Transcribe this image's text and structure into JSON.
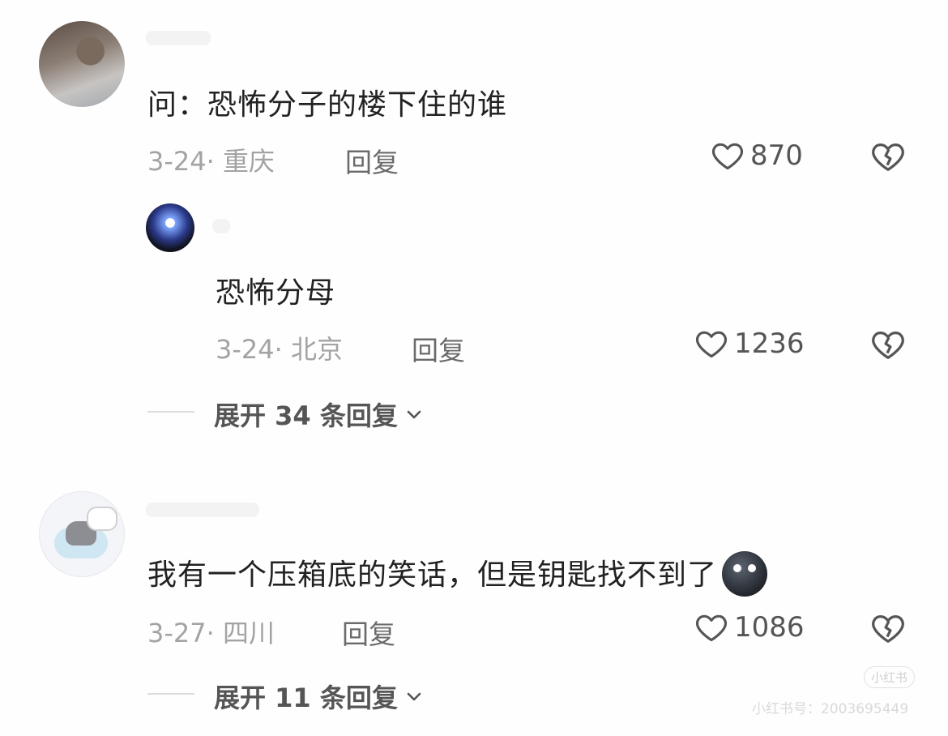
{
  "comments": [
    {
      "text": "问：恐怖分子的楼下住的谁",
      "date": "3-24",
      "location": "重庆",
      "reply_label": "回复",
      "likes": "870",
      "sub_reply": {
        "text": "恐怖分母",
        "date": "3-24",
        "location": "北京",
        "reply_label": "回复",
        "likes": "1236"
      },
      "expand_label": "展开 34 条回复"
    },
    {
      "text": "我有一个压箱底的笑话，但是钥匙找不到了",
      "emoji": "dark-moon-face-emoji",
      "date": "3-27",
      "location": "四川",
      "reply_label": "回复",
      "likes": "1086",
      "expand_label": "展开 11 条回复"
    }
  ],
  "watermark": {
    "badge": "小红书",
    "text": "小红书号：2003695449"
  },
  "colors": {
    "text": "#222222",
    "meta": "#a3a3a3",
    "action": "#555555"
  },
  "icons": [
    "heart-icon",
    "broken-heart-icon",
    "chevron-down-icon"
  ]
}
